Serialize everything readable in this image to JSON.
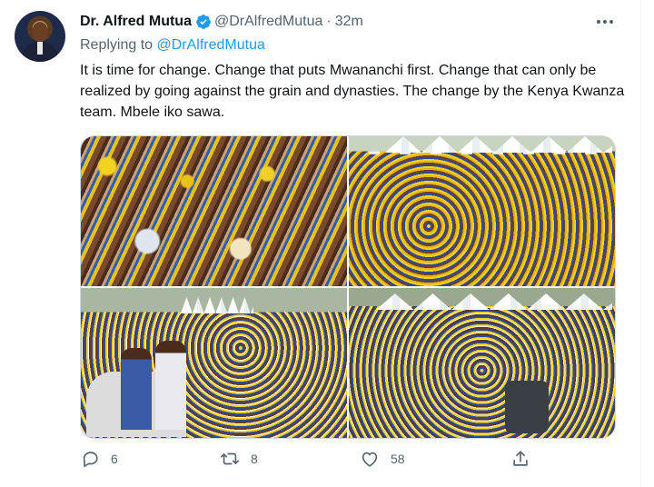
{
  "author": {
    "name": "Dr. Alfred Mutua",
    "handle": "@DrAlfredMutua",
    "separator": "·",
    "time": "32m"
  },
  "reply": {
    "prefix": "Replying to ",
    "to": "@DrAlfredMutua"
  },
  "tweet_text": "It is time for change. Change that puts Mwananchi first. Change that can only be realized by going against the grain and dynasties. The change by the Kenya Kwanza team. Mbele iko sawa.",
  "media": {
    "photos": [
      "crowd-raising-hands",
      "crowd-under-tents",
      "leaders-on-car-addressing-crowd",
      "crowd-rally-aerial"
    ]
  },
  "actions": {
    "reply_count": "6",
    "retweet_count": "8",
    "like_count": "58"
  },
  "colors": {
    "link": "#1d9bf0",
    "muted": "#536471",
    "text": "#0f1419",
    "verified": "#1d9bf0"
  }
}
